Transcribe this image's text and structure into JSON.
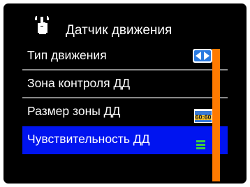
{
  "header": {
    "title": "Датчик движения",
    "icon": "hand-pointer-icon"
  },
  "menu": {
    "items": [
      {
        "label": "Тип движения",
        "icon": "direction-arrows-icon"
      },
      {
        "label": "Зона контроля ДД",
        "icon": ""
      },
      {
        "label": "Размер зоны ДД",
        "icon": "zone-size-icon",
        "icon_text": "60:60"
      },
      {
        "label": "Чувствительность ДД",
        "icon": "sensitivity-bars-icon"
      },
      {
        "label": "",
        "icon": ""
      }
    ],
    "selected_index": 3
  },
  "colors": {
    "background": "#000000",
    "selection": "#0014f0",
    "scrollbar": "#ff7a00",
    "divider": "#8a8a8a",
    "text": "#ffffff",
    "sensitivity_icon": "#3cd23c",
    "direction_icon": "#2a7ae0"
  }
}
